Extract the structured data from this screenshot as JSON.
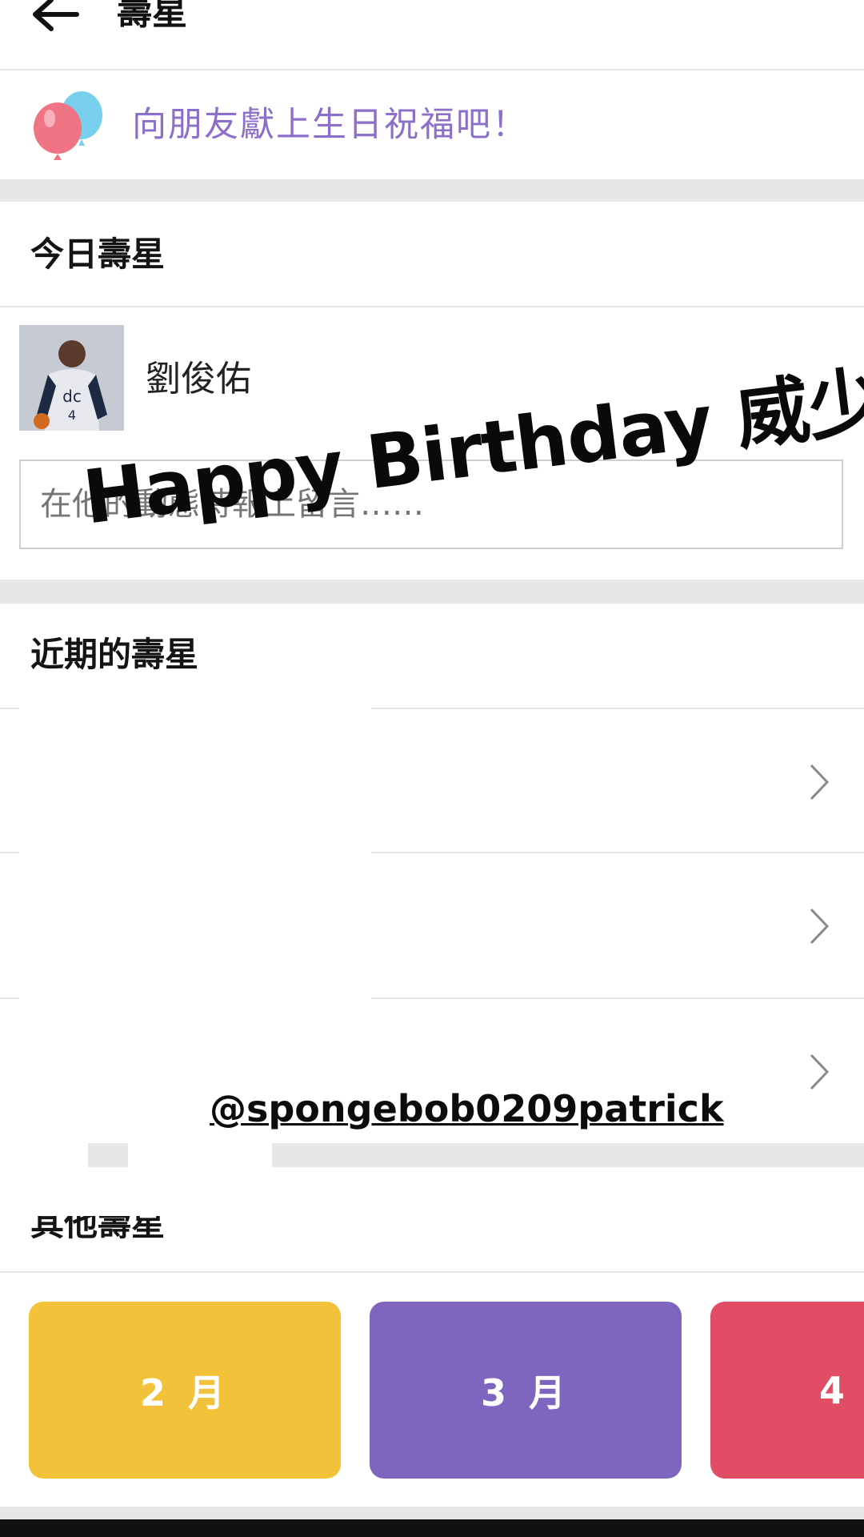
{
  "header": {
    "title": "壽星",
    "back_icon": "arrow-left-icon"
  },
  "banner": {
    "icon": "balloon-icon",
    "text": "向朋友獻上生日祝福吧！",
    "text_color": "#8b6fc9"
  },
  "today": {
    "section_title": "今日壽星",
    "person": {
      "name": "劉俊佑",
      "avatar": "player-photo"
    },
    "post_placeholder": "在他的動態時報上留言……"
  },
  "recent": {
    "section_title": "近期的壽星",
    "rows": [
      {
        "chevron": "chevron-right-icon"
      },
      {
        "chevron": "chevron-right-icon"
      },
      {
        "chevron": "chevron-right-icon"
      }
    ]
  },
  "other": {
    "section_title": "其他壽星",
    "months": [
      {
        "label": "2 月",
        "color": "#f2c33a"
      },
      {
        "label": "3 月",
        "color": "#7d65c0"
      },
      {
        "label": "4",
        "color": "#e04d64"
      }
    ]
  },
  "overlay": {
    "caption": "Happy Birthday 威少",
    "handle": "@spongebob0209patrick"
  }
}
